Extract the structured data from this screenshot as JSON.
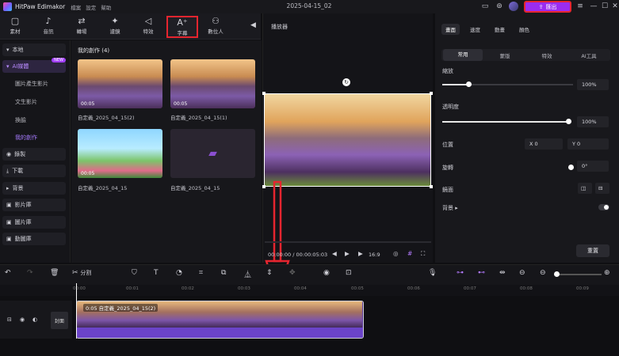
{
  "app": {
    "name": "HitPaw Edimakor",
    "menus": [
      "檔案",
      "設定",
      "幫助"
    ],
    "doc_title": "2025-04-15_02",
    "export_label": "匯出"
  },
  "left_tabs": [
    {
      "label": "素材",
      "icon": "folder-icon"
    },
    {
      "label": "音訊",
      "icon": "music-note-icon"
    },
    {
      "label": "轉場",
      "icon": "transition-icon"
    },
    {
      "label": "濾鏡",
      "icon": "sparkle-icon"
    },
    {
      "label": "特效",
      "icon": "magic-wand-icon"
    },
    {
      "label": "字幕",
      "icon": "text-icon"
    },
    {
      "label": "數位人",
      "icon": "digital-human-icon"
    }
  ],
  "sidebar": {
    "items": [
      {
        "label": "本地",
        "type": "sec"
      },
      {
        "label": "AI媒體",
        "type": "sel",
        "badge": "NEW"
      },
      {
        "label": "圖片產生影片",
        "type": "sub"
      },
      {
        "label": "文生影片",
        "type": "sub"
      },
      {
        "label": "換臉",
        "type": "sub"
      },
      {
        "label": "我的創作",
        "type": "subsel"
      },
      {
        "label": "錄製",
        "type": "sec"
      },
      {
        "label": "下載",
        "type": "sec"
      },
      {
        "label": "背景",
        "type": "sec"
      },
      {
        "label": "影片庫",
        "type": "sec"
      },
      {
        "label": "圖片庫",
        "type": "sec"
      },
      {
        "label": "動圖庫",
        "type": "sec"
      }
    ]
  },
  "media": {
    "heading": "我的創作 (4)",
    "items": [
      {
        "label": "自定義_2025_04_15(2)",
        "duration": "00:05"
      },
      {
        "label": "自定義_2025_04_15(1)",
        "duration": "00:05"
      },
      {
        "label": "自定義_2025_04_15",
        "duration": "00:05"
      },
      {
        "label": "自定義_2025_04_15",
        "duration": ""
      }
    ]
  },
  "player": {
    "title": "播放器",
    "time": "00:00:00 / 00:00:05:03",
    "ratio": "16:9"
  },
  "props": {
    "tabs": [
      "畫面",
      "速度",
      "動畫",
      "顏色"
    ],
    "subtabs": [
      "常用",
      "蒙版",
      "特效",
      "AI工具"
    ],
    "scale_label": "縮放",
    "scale_value": "100%",
    "opacity_label": "透明度",
    "opacity_value": "100%",
    "position_label": "位置",
    "x_value": "X  0",
    "y_value": "Y  0",
    "rotate_label": "旋轉",
    "rotate_value": "0°",
    "mirror_label": "鏡面",
    "bg_label": "背景",
    "reset_label": "重置"
  },
  "toolbar": {
    "split_label": "分割"
  },
  "timeline": {
    "ticks": [
      "00:00",
      "00:01",
      "00:02",
      "00:03",
      "00:04",
      "00:05",
      "00:06",
      "00:07",
      "00:08",
      "00:09"
    ],
    "cover_label": "封面",
    "clip_label": "0:05  自定義_2025_04_15(2)"
  }
}
